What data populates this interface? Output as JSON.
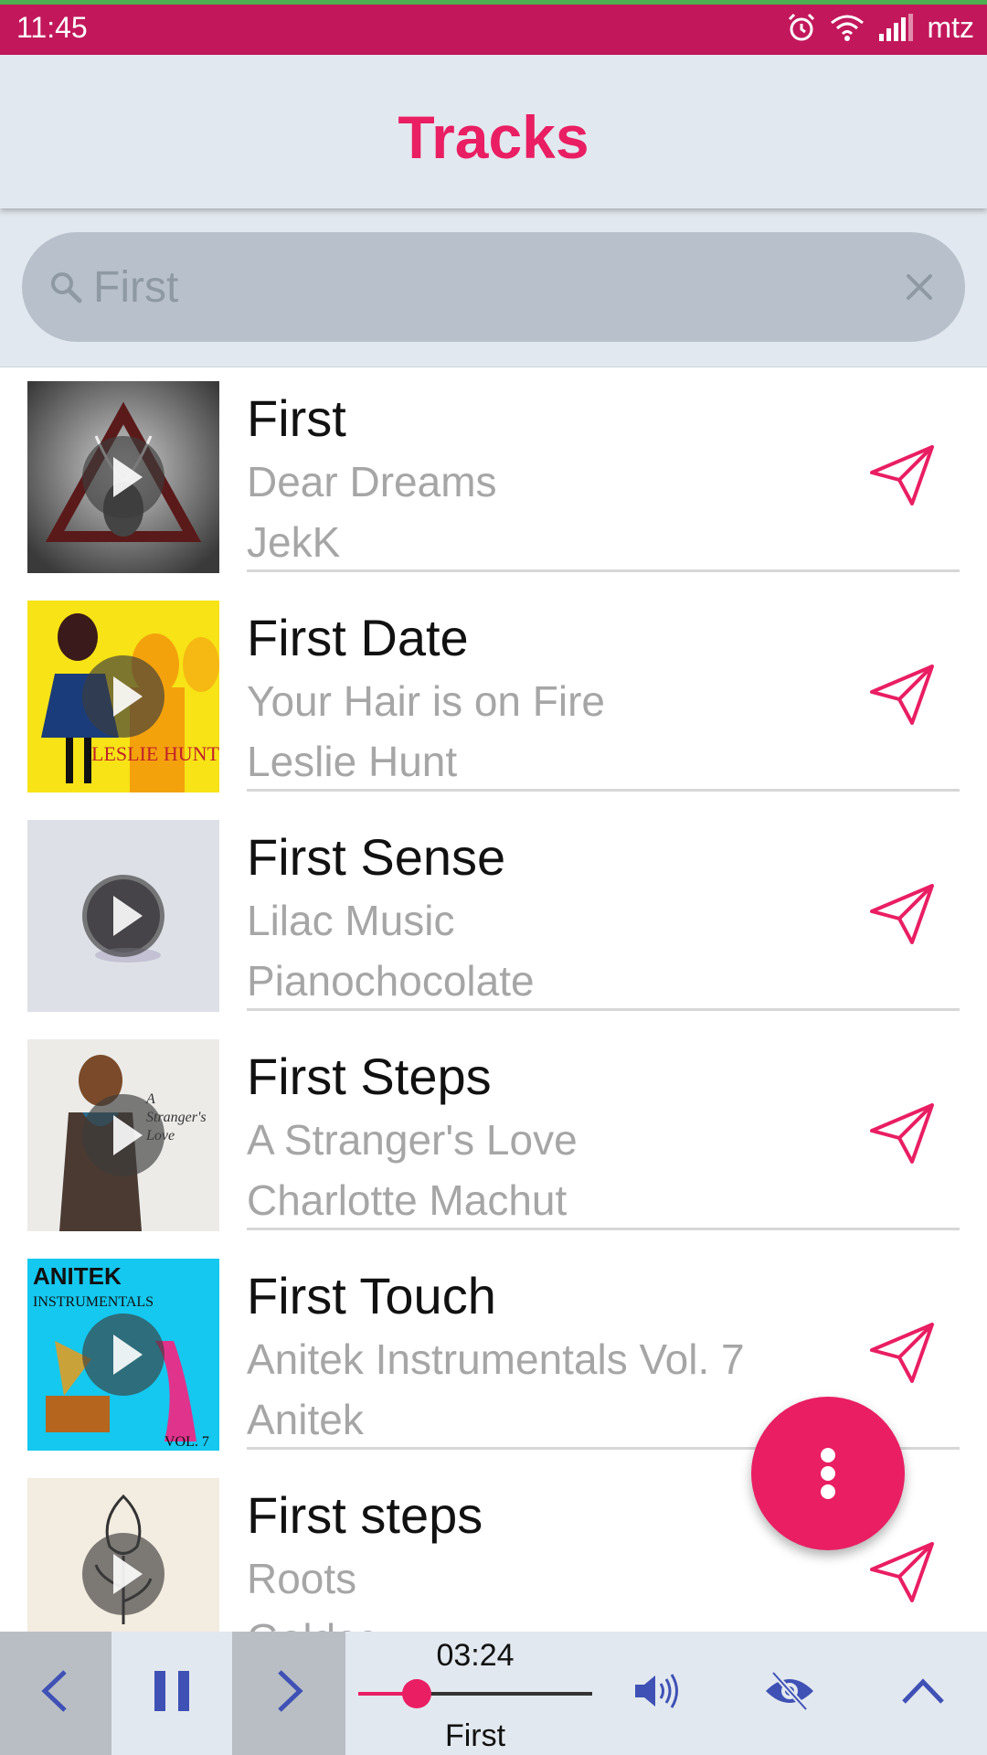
{
  "status_bar": {
    "time": "11:45",
    "carrier": "mtz",
    "icons": [
      "alarm-icon",
      "wifi-icon",
      "signal-icon"
    ],
    "color": "#c2185b"
  },
  "header": {
    "title": "Tracks",
    "title_color": "#e91e63"
  },
  "search": {
    "value": "First",
    "icons": [
      "search-icon",
      "clear-icon"
    ]
  },
  "tracks": [
    {
      "title": "First",
      "album": "Dear Dreams",
      "artist": "JekK"
    },
    {
      "title": "First Date",
      "album": "Your Hair is on Fire",
      "artist": "Leslie Hunt"
    },
    {
      "title": "First Sense",
      "album": "Lilac Music",
      "artist": "Pianochocolate"
    },
    {
      "title": "First Steps",
      "album": "A Stranger's Love",
      "artist": "Charlotte Machut"
    },
    {
      "title": "First Touch",
      "album": "Anitek Instrumentals Vol. 7",
      "artist": "Anitek"
    },
    {
      "title": "First steps",
      "album": "Roots",
      "artist": "Goldcc"
    }
  ],
  "fab": {
    "icon": "more-vertical-icon",
    "color": "#e91e63"
  },
  "player": {
    "elapsed": "03:24",
    "now_playing": "First",
    "progress": 0.25,
    "icons": [
      "previous-icon",
      "pause-icon",
      "next-icon",
      "volume-icon",
      "visibility-off-icon",
      "chevron-up-icon"
    ],
    "accent": "#3f51b5"
  }
}
